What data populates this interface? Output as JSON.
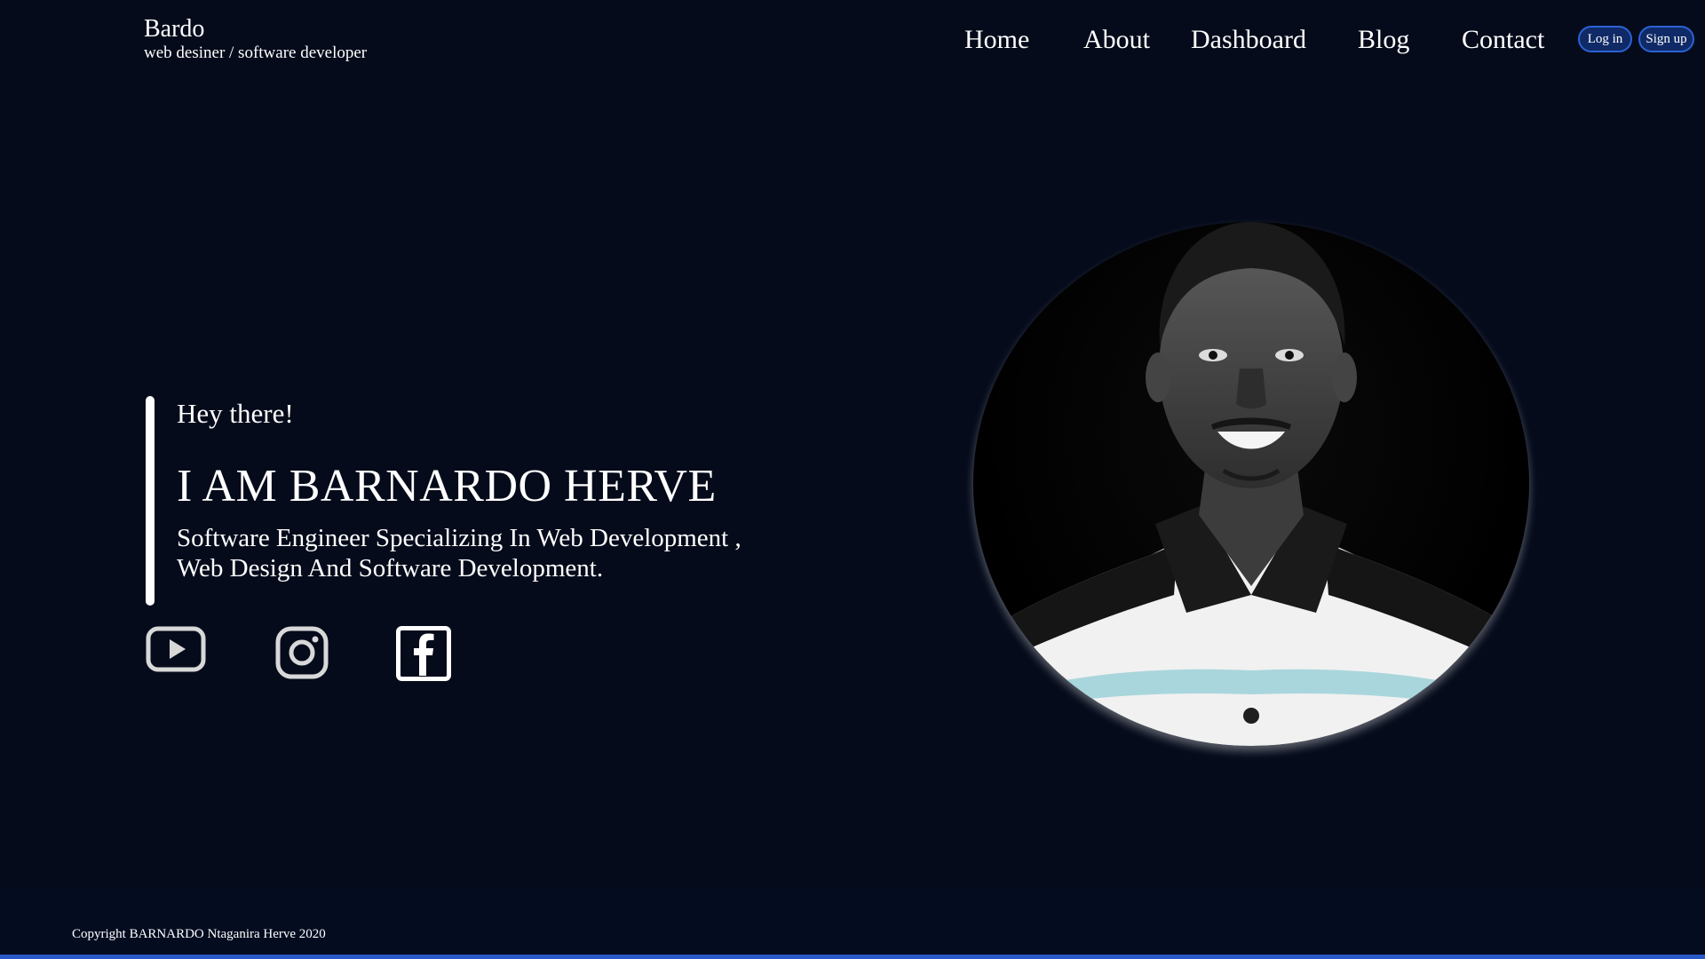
{
  "brand": {
    "name": "Bardo",
    "tagline": "web desiner / software developer"
  },
  "nav": {
    "items": [
      {
        "label": "Home"
      },
      {
        "label": "About"
      },
      {
        "label": "Dashboard"
      },
      {
        "label": "Blog"
      },
      {
        "label": "Contact"
      }
    ]
  },
  "auth": {
    "login_label": "Log in",
    "signup_label": "Sign up"
  },
  "hero": {
    "greeting": "Hey there!",
    "title": "I AM BARNARDO HERVE",
    "subtitle_line1": "Software Engineer Specializing In Web Development ,",
    "subtitle_line2": "Web Design And Software Development."
  },
  "social": {
    "icons": [
      "youtube-icon",
      "instagram-icon",
      "facebook-icon"
    ]
  },
  "portrait": {
    "subject": "profile-photo"
  },
  "footer": {
    "copyright": "Copyright BARNARDO Ntaganira Herve 2020"
  },
  "colors": {
    "background": "#050b1b",
    "accent": "#2c62d6",
    "footer_line": "#2958c8"
  }
}
